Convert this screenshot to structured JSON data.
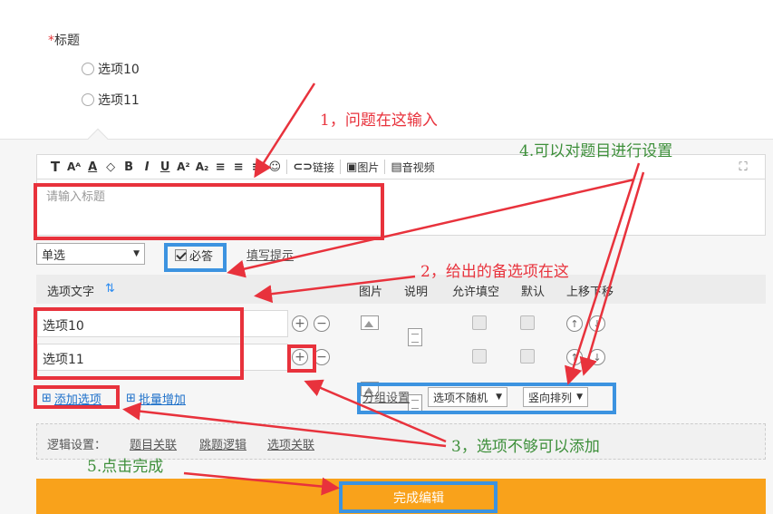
{
  "preview": {
    "required_star": "*",
    "title": "标题",
    "options": [
      "选项10",
      "选项11"
    ]
  },
  "toolbar": {
    "items": [
      "T",
      "A",
      "A",
      "◇",
      "B",
      "I",
      "U",
      "A",
      "A"
    ],
    "link_label": "链接",
    "image_label": "图片",
    "video_label": "音视频"
  },
  "title_input": {
    "placeholder": "请输入标题"
  },
  "type_select": {
    "value": "单选"
  },
  "required_label": "必答",
  "hint_link": "填写提示",
  "table": {
    "headers": {
      "option_text": "选项文字",
      "image": "图片",
      "description": "说明",
      "allow_fill": "允许填空",
      "default": "默认",
      "move": "上移下移"
    },
    "rows": [
      {
        "value": "选项10"
      },
      {
        "value": "选项11"
      }
    ]
  },
  "actions": {
    "add_option": "添加选项",
    "batch_add": "批量增加"
  },
  "group_settings": {
    "label": "分组设置",
    "random_select": "选项不随机",
    "layout_select": "竖向排列"
  },
  "logic": {
    "label": "逻辑设置：",
    "question_link": "题目关联",
    "jump_logic": "跳题逻辑",
    "option_link": "选项关联"
  },
  "done_button": "完成编辑",
  "annotations": {
    "a1": "1，问题在这输入",
    "a2": "2，给出的备选项在这",
    "a3": "3，选项不够可以添加",
    "a4": "4.可以对题目进行设置",
    "a5": "5.点击完成"
  },
  "colors": {
    "annotation_red": "#e8323c",
    "annotation_blue": "#3c93e0",
    "annotation_green": "#3d8f3a",
    "done_button": "#f9a21b",
    "link": "#1c6fc9"
  }
}
